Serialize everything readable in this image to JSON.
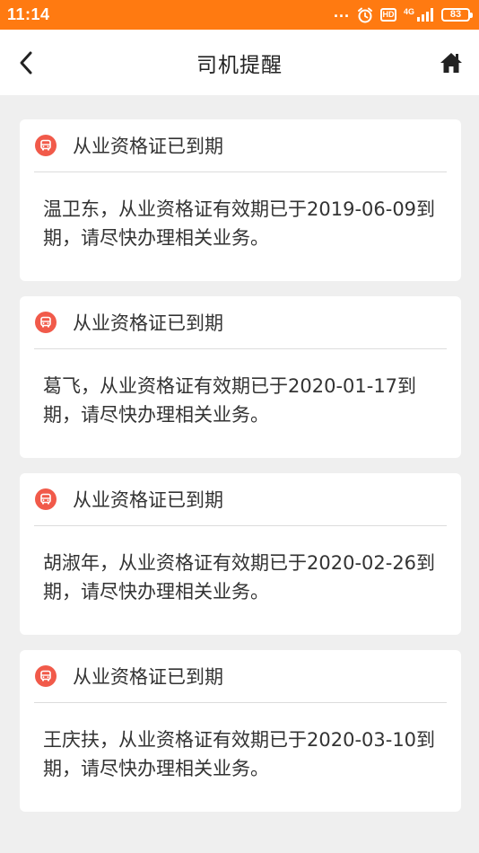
{
  "status_bar": {
    "time": "11:14",
    "dots": "...",
    "hd": "HD",
    "network": "4G",
    "battery": "83"
  },
  "nav": {
    "title": "司机提醒",
    "back_icon": "chevron-left-icon",
    "home_icon": "home-icon"
  },
  "colors": {
    "status_bar": "#ff7a11",
    "icon_badge": "#f15a4a",
    "background": "#efefef"
  },
  "cards": [
    {
      "title": "从业资格证已到期",
      "icon": "bus-icon",
      "body": "温卫东，从业资格证有效期已于2019-06-09到期，请尽快办理相关业务。"
    },
    {
      "title": "从业资格证已到期",
      "icon": "bus-icon",
      "body": "葛飞，从业资格证有效期已于2020-01-17到期，请尽快办理相关业务。"
    },
    {
      "title": "从业资格证已到期",
      "icon": "bus-icon",
      "body": "胡淑年，从业资格证有效期已于2020-02-26到期，请尽快办理相关业务。"
    },
    {
      "title": "从业资格证已到期",
      "icon": "bus-icon",
      "body": "王庆扶，从业资格证有效期已于2020-03-10到期，请尽快办理相关业务。"
    }
  ]
}
